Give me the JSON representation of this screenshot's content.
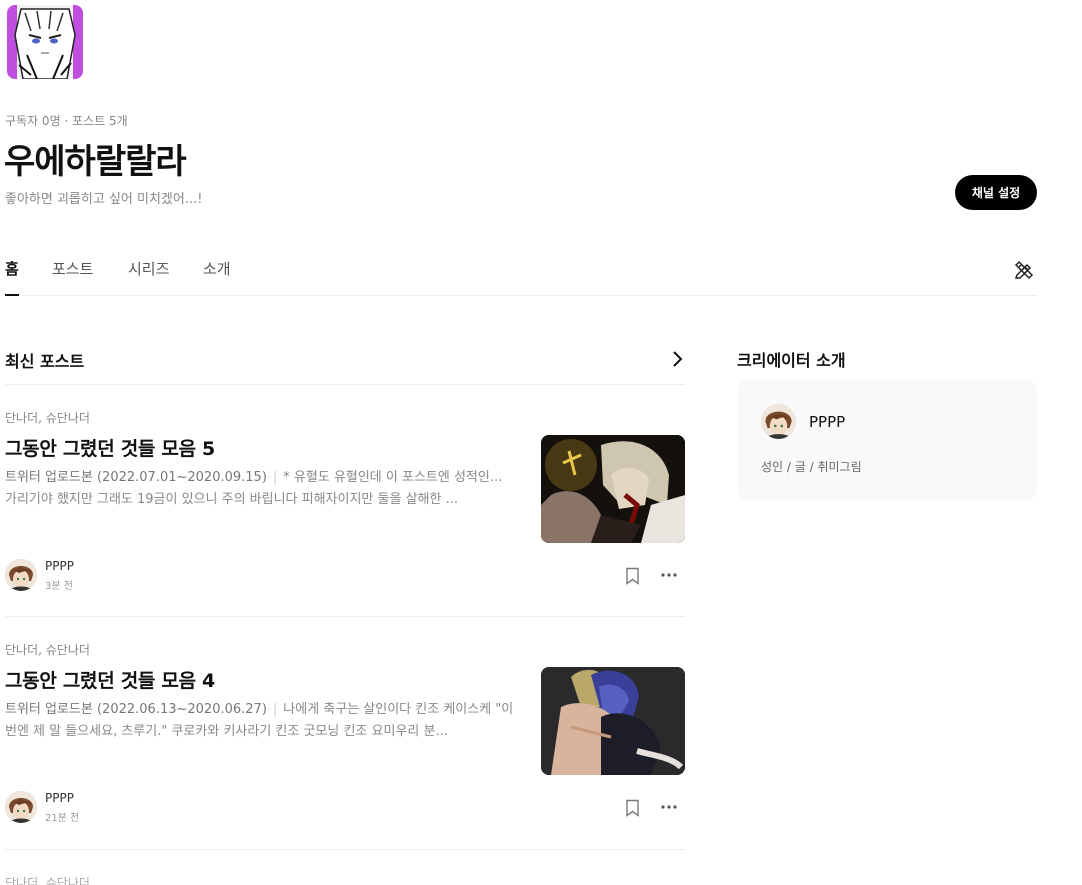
{
  "channel": {
    "stats": "구독자 0명 · 포스트 5개",
    "title": "우에하랄랄라",
    "description": "좋아하면 괴롭히고 싶어 미치겠어...!",
    "settings_label": "채널 설정",
    "avatar_icon": "channel-avatar-image"
  },
  "tabs": [
    {
      "label": "홈",
      "active": true
    },
    {
      "label": "포스트",
      "active": false
    },
    {
      "label": "시리즈",
      "active": false
    },
    {
      "label": "소개",
      "active": false
    }
  ],
  "latest": {
    "title": "최신 포스트",
    "posts": [
      {
        "category": "단나더, 슈단나더",
        "title": "그동안 그렸던 것들 모음 5",
        "excerpt_lead": "트위터 업로드본 (2022.07.01~2020.09.15)",
        "excerpt_sep": "|",
        "excerpt_rest": "* 유혈도 유혈인데 이 포스트엔 성적인... 가리기야 했지만 그래도 19금이 있으니 주의 바립니다 피해자이지만 둘을 살해한 ...",
        "author": "PPPP",
        "time": "3분 전"
      },
      {
        "category": "단나더, 슈단나더",
        "title": "그동안 그렸던 것들 모음 4",
        "excerpt_lead": "트위터 업로드본 (2022.06.13~2020.06.27)",
        "excerpt_sep": "|",
        "excerpt_rest": "나에게 축구는 살인이다 킨조 케이스케 \"이번엔 제 말 들으세요, 츠루기.\" 쿠로카와 키사라기 킨조 굿모닝 킨조 요미우리 분...",
        "author": "PPPP",
        "time": "21분 전"
      }
    ],
    "next_category": "단나더, 슈단나더"
  },
  "sidebar": {
    "title": "크리에이터 소개",
    "creator_name": "PPPP",
    "creator_tags": "성인 / 글 / 취미그림"
  },
  "colors": {
    "accent": "#000000",
    "card_bg": "#f9f9f9",
    "muted_text": "#888888"
  }
}
